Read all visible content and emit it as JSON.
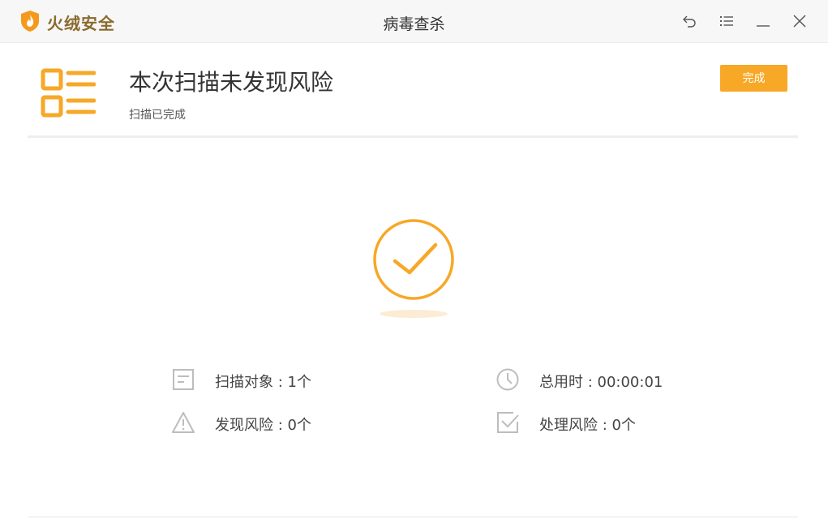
{
  "app": {
    "brand": "火绒安全",
    "window_title": "病毒查杀"
  },
  "window_controls": [
    "back-icon",
    "menu-icon",
    "minimize-icon",
    "close-icon"
  ],
  "result": {
    "headline": "本次扫描未发现风险",
    "subline": "扫描已完成",
    "done_label": "完成"
  },
  "stats": {
    "scan_objects": "扫描对象 : 1个",
    "risks_found": "发现风险 : 0个",
    "total_time": "总用时 : 00:00:01",
    "risks_handled": "处理风险 : 0个"
  },
  "colors": {
    "accent": "#f7a827",
    "brand_text": "#8a6a2e",
    "icon_gray": "#bdbdbd"
  }
}
